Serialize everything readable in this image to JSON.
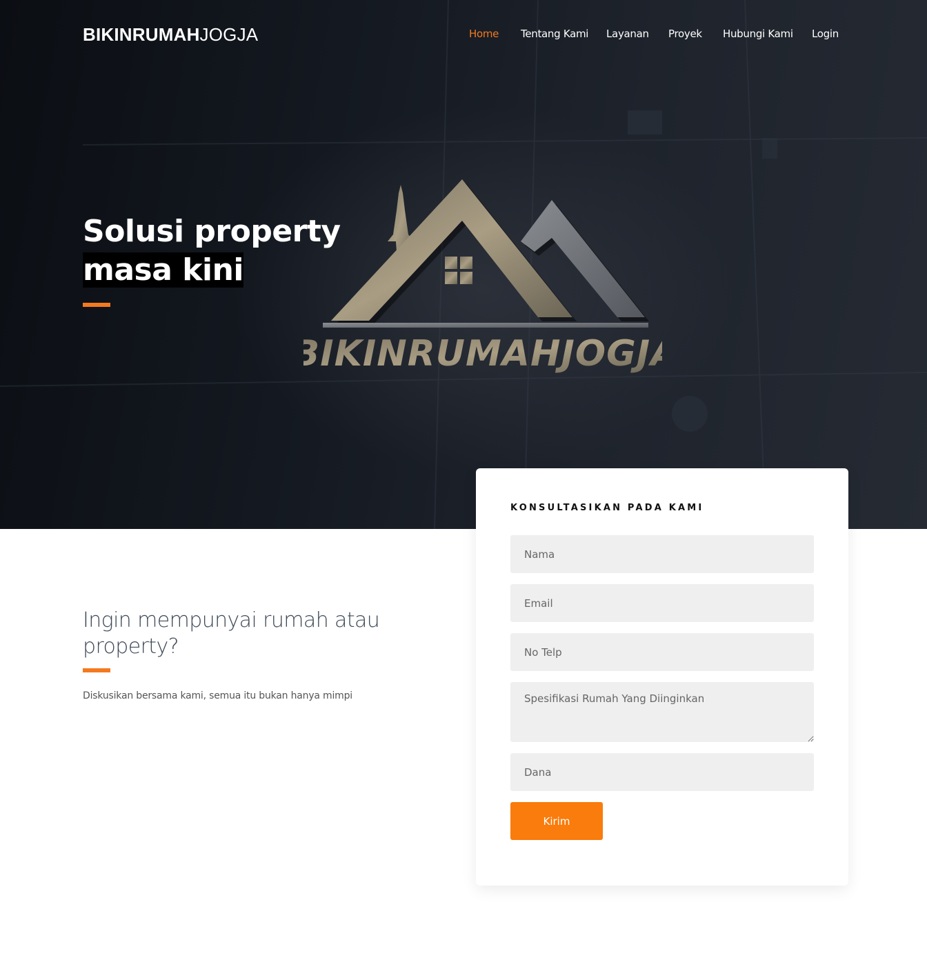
{
  "brand": {
    "bold": "BIKINRUMAH",
    "light": "JOGJA"
  },
  "nav": {
    "items": [
      {
        "label": "Home",
        "active": true
      },
      {
        "label": "Tentang Kami",
        "active": false
      },
      {
        "label": "Layanan",
        "active": false
      },
      {
        "label": "Proyek",
        "active": false
      },
      {
        "label": "Hubungi Kami",
        "active": false
      },
      {
        "label": "Login",
        "active": false
      }
    ]
  },
  "hero": {
    "title_line1": "Solusi property",
    "title_line2": "masa kini",
    "sign_text": "BIKINRUMAHJOGJA"
  },
  "intro": {
    "heading": "Ingin mempunyai rumah atau property?",
    "text": "Diskusikan bersama kami, semua itu bukan hanya mimpi"
  },
  "form": {
    "title": "KONSULTASIKAN PADA KAMI",
    "fields": {
      "nama": "Nama",
      "email": "Email",
      "telp": "No Telp",
      "spesifikasi": "Spesifikasi Rumah Yang Diinginkan",
      "dana": "Dana"
    },
    "submit_label": "Kirim"
  },
  "colors": {
    "accent": "#f47a1f",
    "button": "#f97c0c",
    "hero_dark": "#141921",
    "field_bg": "#efefef"
  }
}
